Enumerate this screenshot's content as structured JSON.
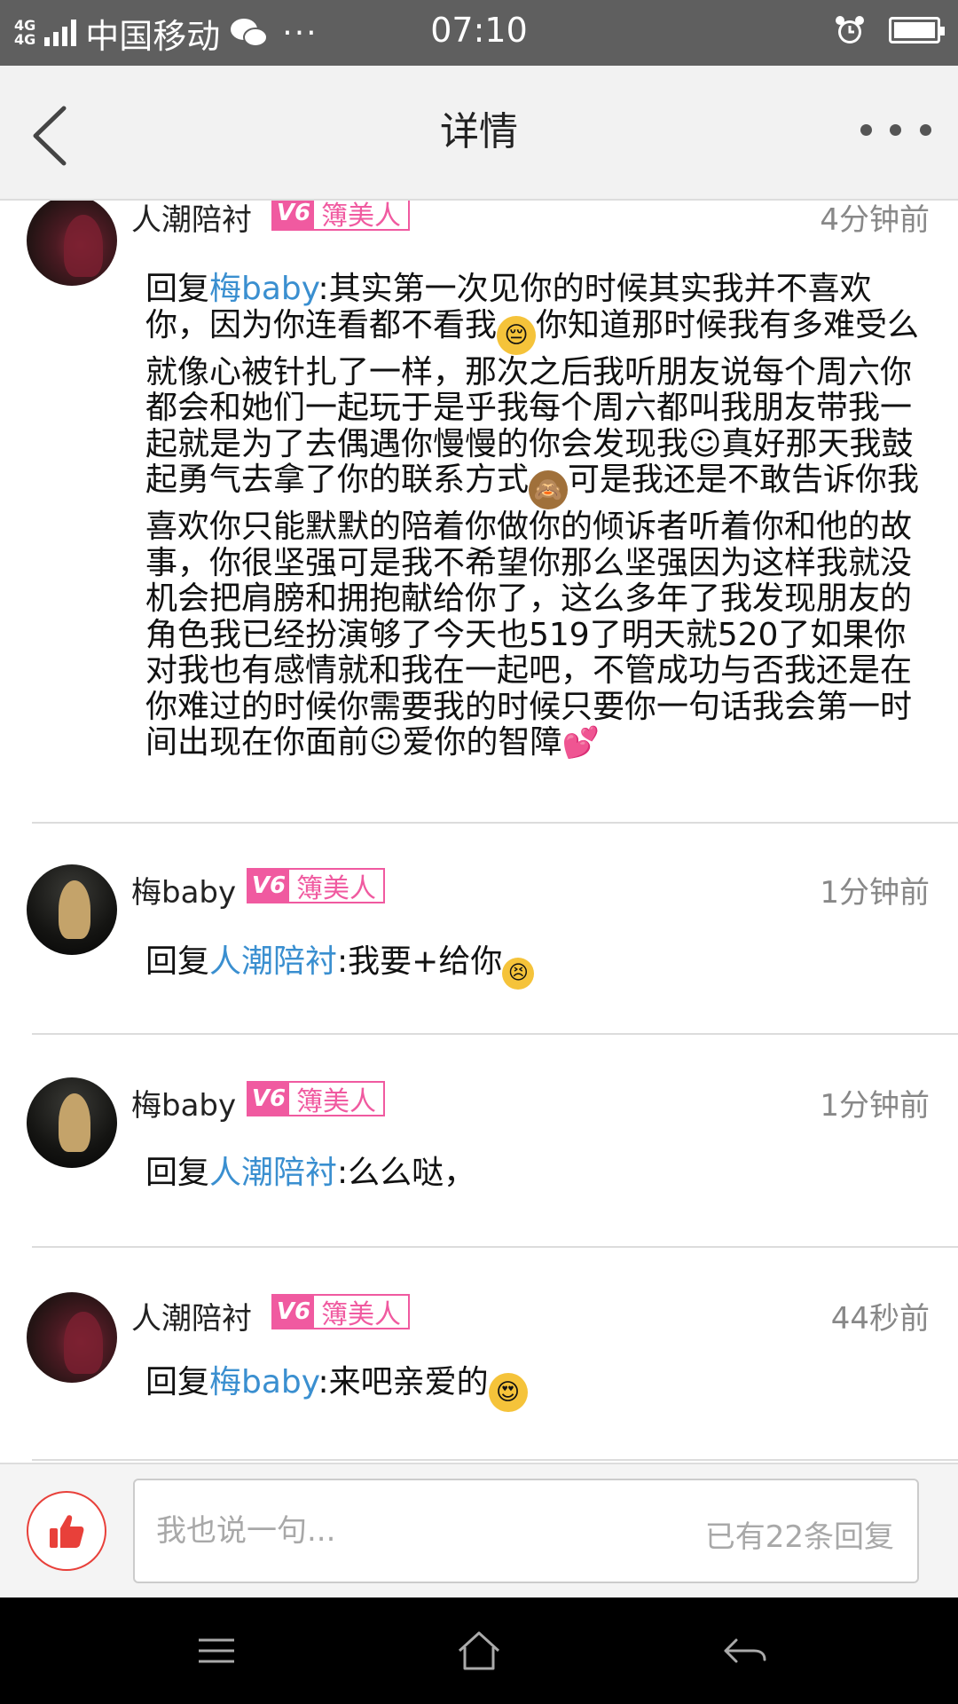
{
  "status_bar": {
    "network": "4G",
    "carrier": "中国移动",
    "more": "···",
    "time": "07:10"
  },
  "header": {
    "title": "详情"
  },
  "comments": [
    {
      "username": "人潮陪衬",
      "badge_level": "V6",
      "badge_title": "簿美人",
      "time": "4分钟前",
      "reply_label": "回复",
      "mention": "梅baby",
      "text_before_emoji": ":其实第一次见你的时候其实我并不喜欢你，因为你连看都不看我",
      "text_rest": "你知道那时候我有多难受么就像心被针扎了一样，那次之后我听朋友说每个周六你都会和她们一起玩于是乎我每个周六都叫我朋友带我一起就是为了去偶遇你慢慢的你会发现我☺真好那天我鼓起勇气去拿了你的联系方式",
      "text_rest2": "可是我还是不敢告诉你我喜欢你只能默默的陪着你做你的倾诉者听着你和他的故事，你很坚强可是我不希望你那么坚强因为这样我就没机会把肩膀和拥抱献给你了，这么多年了我发现朋友的角色我已经扮演够了今天也519了明天就520了如果你对我也有感情就和我在一起吧，不管成功与否我还是在你难过的时候你需要我的时候只要你一句话我会第一时间出现在你面前☺爱你的智障"
    },
    {
      "username": "梅baby",
      "badge_level": "V6",
      "badge_title": "簿美人",
      "time": "1分钟前",
      "reply_label": "回复",
      "mention": "人潮陪衬",
      "text": ":我要+给你"
    },
    {
      "username": "梅baby",
      "badge_level": "V6",
      "badge_title": "簿美人",
      "time": "1分钟前",
      "reply_label": "回复",
      "mention": "人潮陪衬",
      "text": ":么么哒，"
    },
    {
      "username": "人潮陪衬",
      "badge_level": "V6",
      "badge_title": "簿美人",
      "time": "44秒前",
      "reply_label": "回复",
      "mention": "梅baby",
      "text": ":来吧亲爱的"
    }
  ],
  "input": {
    "placeholder": "我也说一句...",
    "reply_count": "已有22条回复"
  },
  "icons": {
    "like": "thumbs-up-icon",
    "back": "chevron-left-icon",
    "more": "more-dots-icon",
    "nav_menu": "menu-icon",
    "nav_home": "home-icon",
    "nav_back": "back-arrow-icon"
  },
  "colors": {
    "mention": "#3a8fd0",
    "badge": "#f05aa0",
    "like": "#e8403a"
  }
}
